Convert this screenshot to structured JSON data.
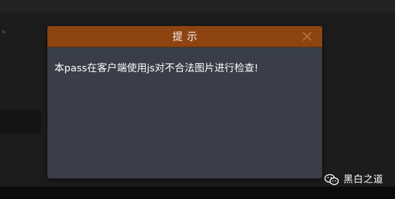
{
  "background": {
    "dot": "。"
  },
  "dialog": {
    "title": "提示",
    "message": "本pass在客户端使用js对不合法图片进行检查!",
    "close_icon": "close-icon"
  },
  "watermark": {
    "icon": "wechat-icon",
    "text": "黑白之道"
  },
  "colors": {
    "header": "#8e4410",
    "dialog_body": "#3a3e49",
    "page_background": "#1c1c1c"
  }
}
